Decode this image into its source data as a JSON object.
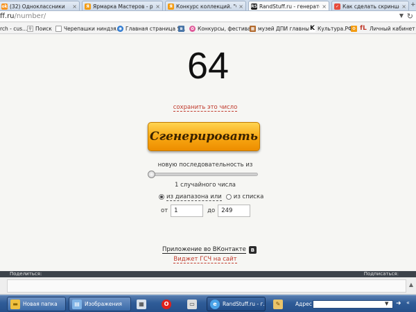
{
  "tabs": [
    {
      "title": "(32) Одноклассники",
      "fav_color": "#f7931e",
      "fav_glyph": "ok",
      "active": false
    },
    {
      "title": "Ярмарка Мастеров - руч",
      "fav_color": "#f39c12",
      "fav_glyph": "ярмарка",
      "active": false
    },
    {
      "title": "Конкурс коллекций. \"Ска",
      "fav_color": "#f39c12",
      "fav_glyph": "ярмарка",
      "active": false
    },
    {
      "title": "RandStuff.ru - генератор",
      "fav_color": "#222222",
      "fav_glyph": "randstuff",
      "active": true
    },
    {
      "title": "Как сделать скриншот —",
      "fav_color": "#e74c3c",
      "fav_glyph": "page",
      "active": false
    }
  ],
  "address": {
    "host_tail": "ff.ru",
    "path": "/number/"
  },
  "bookmarks": [
    {
      "label": "rch - cus...",
      "icon": "none"
    },
    {
      "label": "Поиск",
      "icon": "search"
    },
    {
      "label": "Черепашки ниндзя...",
      "icon": "page"
    },
    {
      "label": "Главная страница S...",
      "icon": "globe"
    },
    {
      "label": "",
      "icon": "vk"
    },
    {
      "label": "Конкурсы, фестива...",
      "icon": "flower"
    },
    {
      "label": "музей ДПИ главный",
      "icon": "grid"
    },
    {
      "label": "Культура.РФ",
      "icon": "k"
    },
    {
      "label": "Личный кабинет",
      "icon": "fl"
    }
  ],
  "generator": {
    "number": "64",
    "save_link": "сохранить это число",
    "button_label": "Сгенерировать",
    "sequence_label": "новую последовательность из",
    "count_text": "1 случайного числа",
    "radio_range_label": "из диапазона или",
    "radio_list_label": "из списка",
    "from_label": "от",
    "from_value": "1",
    "to_label": "до",
    "to_value": "249",
    "vk_app_label": "Приложение во ВКонтакте",
    "vk_badge": "В",
    "widget_link": "Виджет ГСЧ на сайт"
  },
  "share": {
    "left_label": "Поделиться:",
    "right_label": "Подписаться:"
  },
  "taskbar": {
    "items": [
      {
        "label": "Новая папка",
        "icon": "folder",
        "icon_color": "#f0c040"
      },
      {
        "label": "Изображения",
        "icon": "images",
        "icon_color": "#7fb3e6"
      },
      {
        "label": "",
        "icon": "calculator",
        "icon_color": "#d9e2ec"
      },
      {
        "label": "",
        "icon": "opera",
        "icon_color": "#e0201b"
      },
      {
        "label": "",
        "icon": "scanner",
        "icon_color": "#dddddd"
      },
      {
        "label": "RandStuff.ru - г...",
        "icon": "browser",
        "icon_color": "#4aa3e8"
      },
      {
        "label": "",
        "icon": "paint",
        "icon_color": "#e9c46a"
      }
    ],
    "address_label": "Адрес"
  }
}
